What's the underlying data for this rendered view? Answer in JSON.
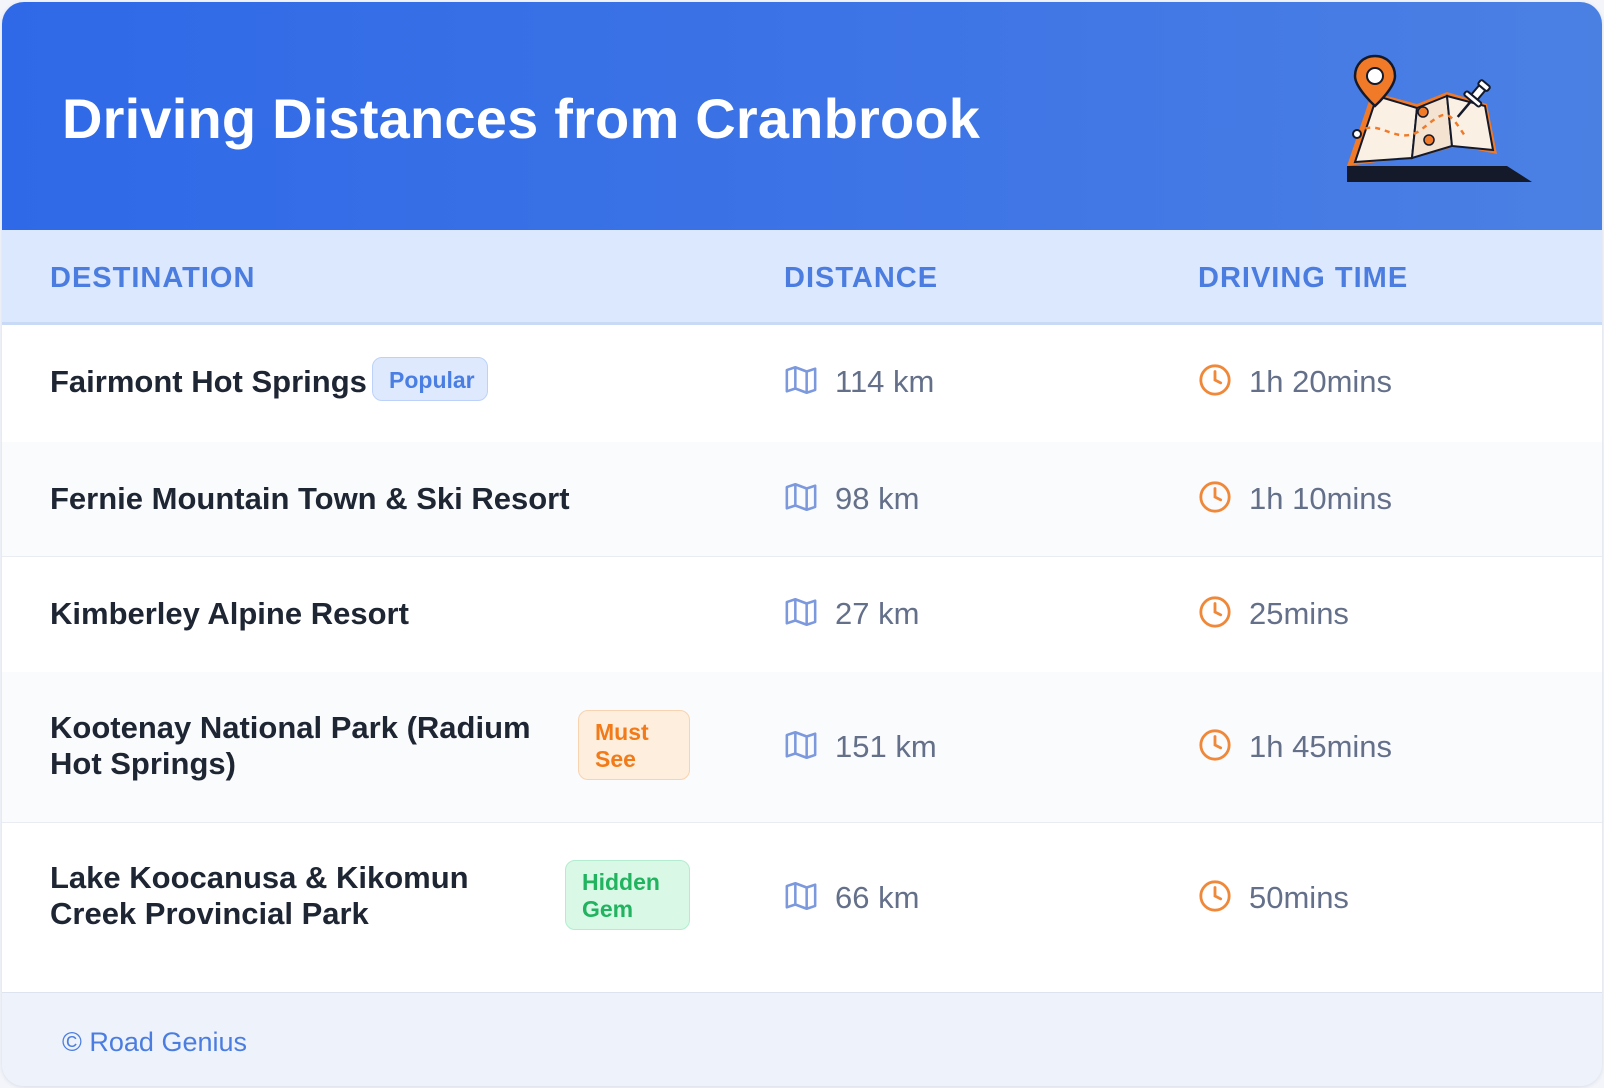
{
  "header": {
    "title": "Driving Distances from Cranbrook",
    "illustration_icon": "map-with-pin-icon"
  },
  "columns": {
    "destination": "DESTINATION",
    "distance": "DISTANCE",
    "driving_time": "DRIVING TIME"
  },
  "rows": [
    {
      "destination": "Fairmont Hot Springs",
      "badge": "Popular",
      "distance": "114 km",
      "time": "1h 20mins"
    },
    {
      "destination": "Fernie Mountain Town & Ski Resort",
      "badge": "",
      "distance": "98 km",
      "time": "1h 10mins"
    },
    {
      "destination": "Kimberley Alpine Resort",
      "badge": "",
      "distance": "27 km",
      "time": "25mins"
    },
    {
      "destination": "Kootenay National Park (Radium Hot Springs)",
      "badge": "Must See",
      "distance": "151 km",
      "time": "1h 45mins"
    },
    {
      "destination": "Lake Koocanusa & Kikomun Creek Provincial Park",
      "badge": "Hidden Gem",
      "distance": "66 km",
      "time": "50mins"
    }
  ],
  "footer": {
    "credit": "© Road Genius"
  },
  "colors": {
    "header_bg": "#3069e7",
    "accent_blue": "#4b7de0",
    "clock_orange": "#f0883a",
    "popular_badge": "#4a7ee3",
    "must_see_badge": "#f27a18",
    "hidden_gem_badge": "#21b35f"
  },
  "icons": {
    "distance": "map-icon",
    "time": "clock-icon"
  }
}
